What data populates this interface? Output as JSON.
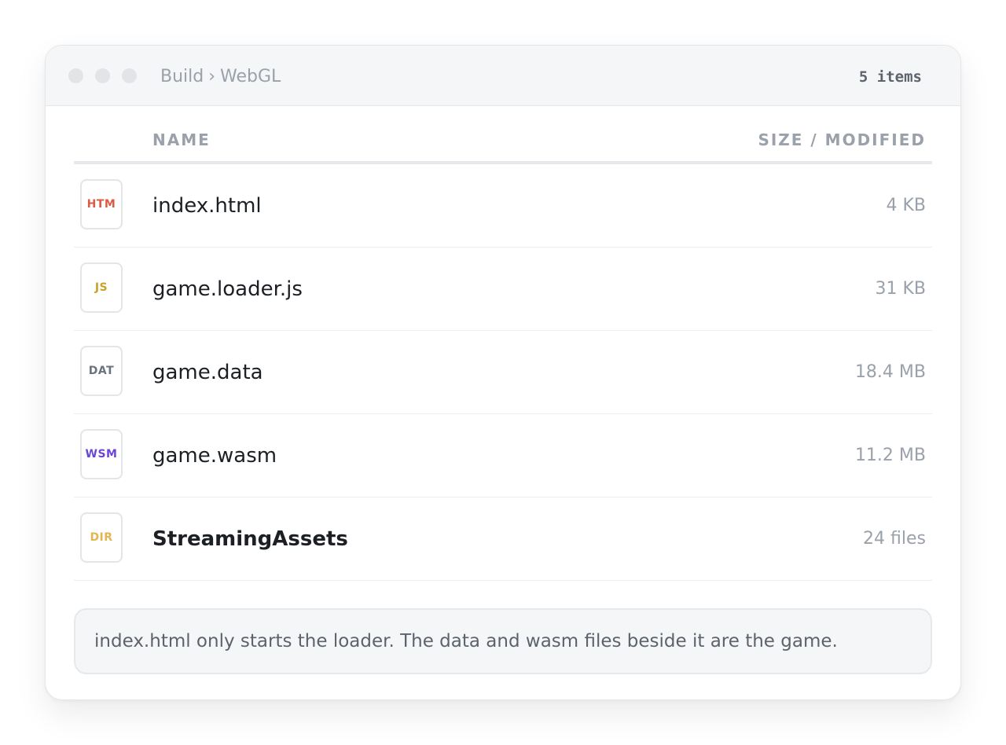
{
  "window": {
    "breadcrumb": [
      "Build",
      "WebGL"
    ],
    "breadcrumb_separator": "›",
    "item_count": "5 items"
  },
  "table": {
    "columns": {
      "name": "NAME",
      "size": "SIZE / MODIFIED"
    },
    "rows": [
      {
        "icon_label": "HTM",
        "icon_color": "#dc5b43",
        "icon_name": "html-file-icon",
        "name": "index.html",
        "size": "4 KB",
        "is_folder": false
      },
      {
        "icon_label": "JS",
        "icon_color": "#c9a227",
        "icon_name": "js-file-icon",
        "name": "game.loader.js",
        "size": "31 KB",
        "is_folder": false
      },
      {
        "icon_label": "DAT",
        "icon_color": "#6b7280",
        "icon_name": "data-file-icon",
        "name": "game.data",
        "size": "18.4 MB",
        "is_folder": false
      },
      {
        "icon_label": "WSM",
        "icon_color": "#6b46d6",
        "icon_name": "wasm-file-icon",
        "name": "game.wasm",
        "size": "11.2 MB",
        "is_folder": false
      },
      {
        "icon_label": "DIR",
        "icon_color": "#e0b64f",
        "icon_name": "folder-icon",
        "name": "StreamingAssets",
        "size": "24 files",
        "is_folder": true
      }
    ]
  },
  "note": "index.html only starts the loader. The data and wasm files beside it are the game.",
  "colors": {
    "titlebar_bg": "#f5f6f8",
    "muted_text": "#9aa1ab",
    "body_text": "#1c1f24"
  }
}
